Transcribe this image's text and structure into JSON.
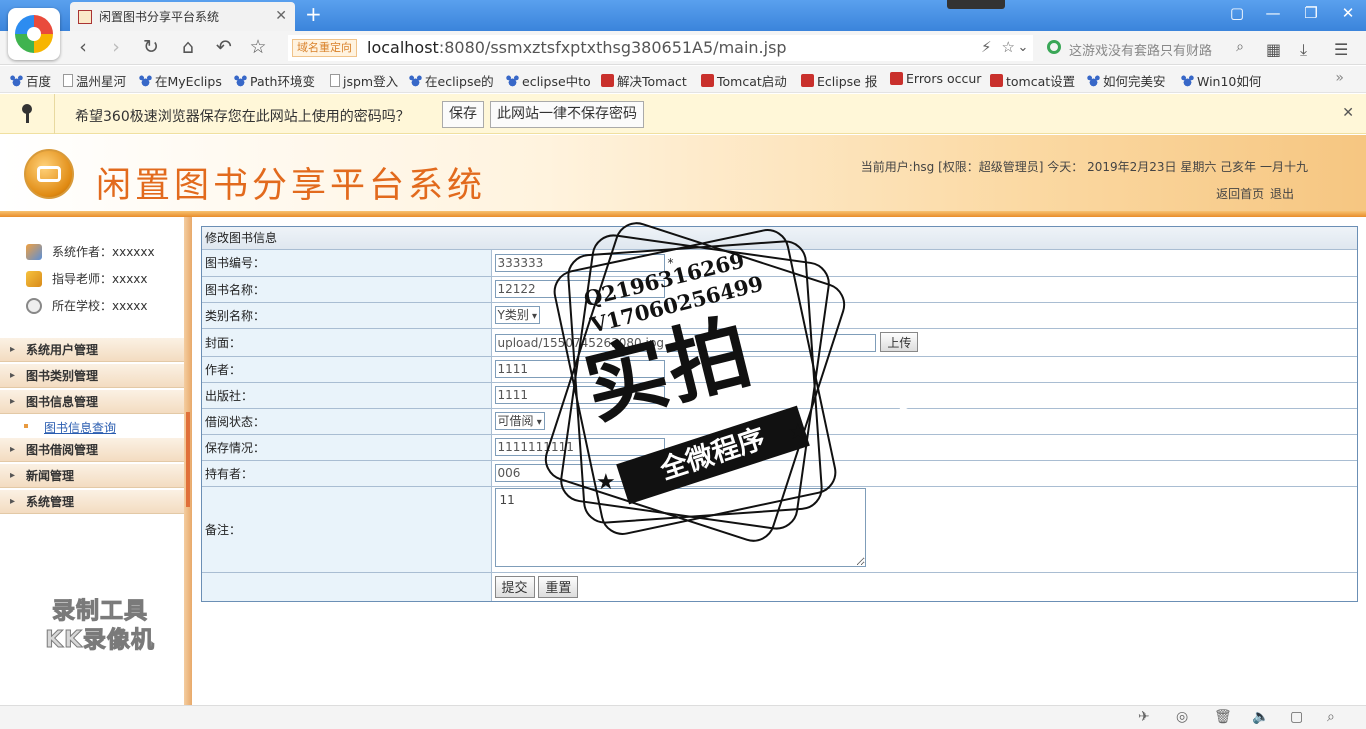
{
  "browser": {
    "tab_title": "闲置图书分享平台系统",
    "redirect_badge": "域名重定向",
    "url_host": "localhost",
    "url_rest": ":8080/ssmxztsfxptxthsg380651A5/main.jsp",
    "search_placeholder": "这游戏没有套路只有财路",
    "bookmarks": [
      "百度",
      "温州星河",
      "在MyEclips",
      "Path环境变",
      "jspm登入",
      "在eclipse的",
      "eclipse中to",
      "解决Tomact",
      "Tomcat启动",
      "Eclipse 报",
      "Errors occur",
      "tomcat设置",
      "如何完美安",
      "Win10如何"
    ],
    "password_bar": {
      "message": "希望360极速浏览器保存您在此网站上使用的密码吗？",
      "save_label": "保存",
      "never_label": "此网站一律不保存密码"
    }
  },
  "header": {
    "title": "闲置图书分享平台系统",
    "user_info": "当前用户:hsg [权限：超级管理员] 今天： 2019年2月23日 星期六 己亥年 一月十九",
    "home_link": "返回首页",
    "logout_link": "退出"
  },
  "sidebar": {
    "info": [
      "系统作者：xxxxxx",
      "指导老师：xxxxx",
      "所在学校：xxxxx"
    ],
    "menu": [
      "系统用户管理",
      "图书类别管理",
      "图书信息管理",
      "图书借阅管理",
      "新闻管理",
      "系统管理"
    ],
    "submenu_active": "图书信息查询",
    "watermark_line1": "录制工具",
    "watermark_line2": "KK录像机"
  },
  "form": {
    "caption": "修改图书信息",
    "labels": {
      "book_no": "图书编号：",
      "book_name": "图书名称：",
      "category": "类别名称：",
      "cover": "封面：",
      "author": "作者：",
      "publisher": "出版社：",
      "borrow_status": "借阅状态：",
      "preservation": "保存情况：",
      "holder": "持有者：",
      "remark": "备注："
    },
    "values": {
      "book_no": "333333",
      "book_name": "12122",
      "category": "Y类别",
      "cover": "upload/1550745263080.jpg",
      "author": "1111",
      "publisher": "1111",
      "borrow_status": "可借阅",
      "preservation": "1111111111",
      "holder": "006",
      "remark": "11"
    },
    "required_mark": "*",
    "upload_label": "上传",
    "submit_label": "提交",
    "reset_label": "重置"
  },
  "stamp": {
    "line1": "Q2196316269",
    "line2": "V17060256499",
    "big": "实拍",
    "ribbon": "全微程序"
  }
}
